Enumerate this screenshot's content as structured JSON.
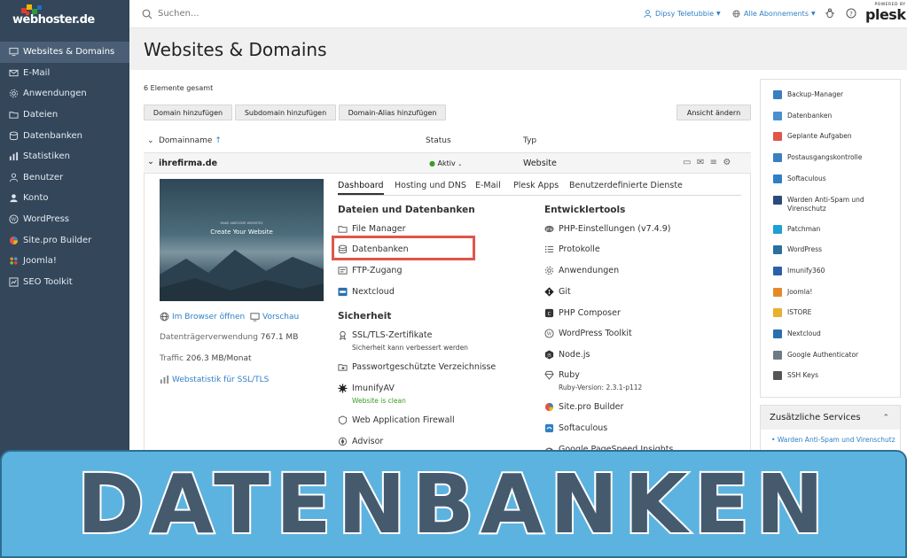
{
  "colors": {
    "sidebar": "#33465a",
    "sidebar_active": "#4a5f75",
    "link": "#2f7fc5",
    "highlight": "#e0564a",
    "banner": "#5db3df",
    "banner_text": "#465a6e",
    "status_green": "#3b9b28"
  },
  "logo": {
    "text": "webhoster.de"
  },
  "sidebar": {
    "items": [
      {
        "label": "Websites & Domains",
        "icon": "monitor-icon",
        "active": true
      },
      {
        "label": "E-Mail",
        "icon": "mail-icon"
      },
      {
        "label": "Anwendungen",
        "icon": "gear-icon"
      },
      {
        "label": "Dateien",
        "icon": "folder-icon"
      },
      {
        "label": "Datenbanken",
        "icon": "database-icon"
      },
      {
        "label": "Statistiken",
        "icon": "bar-chart-icon"
      },
      {
        "label": "Benutzer",
        "icon": "user-icon"
      },
      {
        "label": "Konto",
        "icon": "account-icon"
      },
      {
        "label": "WordPress",
        "icon": "wordpress-icon"
      },
      {
        "label": "Site.pro Builder",
        "icon": "sitepro-icon"
      },
      {
        "label": "Joomla!",
        "icon": "joomla-icon"
      },
      {
        "label": "SEO Toolkit",
        "icon": "seo-icon"
      }
    ]
  },
  "topbar": {
    "search_placeholder": "Suchen...",
    "user": "Dipsy Teletubbie",
    "subscriptions": "Alle Abonnements",
    "powered_by": "POWERED BY",
    "plesk": "plesk"
  },
  "page": {
    "title": "Websites & Domains",
    "count": "6 Elemente gesamt"
  },
  "toolbar": {
    "add_domain": "Domain hinzufügen",
    "add_subdomain": "Subdomain hinzufügen",
    "add_alias": "Domain-Alias hinzufügen",
    "change_view": "Ansicht ändern"
  },
  "table": {
    "col_domain": "Domainname",
    "col_status": "Status",
    "col_type": "Typ",
    "sort_indicator": "↑",
    "row": {
      "domain": "ihrefirma.de",
      "status": "Aktiv",
      "type": "Website"
    }
  },
  "preview": {
    "subtitle": "MAKE AWESOME WEBSITES",
    "headline": "Create Your Website",
    "open_browser": "Im Browser öffnen",
    "preview": "Vorschau",
    "disk_label": "Datenträgerverwendung",
    "disk_value": "767.1 MB",
    "traffic_label": "Traffic",
    "traffic_value": "206.3 MB/Monat",
    "stats": "Webstatistik für SSL/TLS"
  },
  "tabs": [
    "Dashboard",
    "Hosting und DNS",
    "E-Mail",
    "Plesk Apps",
    "Benutzerdefinierte Dienste"
  ],
  "dashboard": {
    "files_title": "Dateien und Datenbanken",
    "file_manager": "File Manager",
    "databases": "Datenbanken",
    "ftp": "FTP-Zugang",
    "nextcloud": "Nextcloud",
    "security_title": "Sicherheit",
    "ssl": "SSL/TLS-Zertifikate",
    "ssl_note": "Sicherheit kann verbessert werden",
    "protected_dirs": "Passwortgeschützte Verzeichnisse",
    "imunify": "ImunifyAV",
    "imunify_note": "Website is clean",
    "waf": "Web Application Firewall",
    "advisor": "Advisor",
    "dev_title": "Entwicklertools",
    "php": "PHP-Einstellungen (v7.4.9)",
    "logs": "Protokolle",
    "apps": "Anwendungen",
    "git": "Git",
    "composer": "PHP Composer",
    "wp_toolkit": "WordPress Toolkit",
    "nodejs": "Node.js",
    "ruby": "Ruby",
    "ruby_note": "Ruby-Version: 2.3.1-p112",
    "sitepro": "Site.pro Builder",
    "softaculous": "Softaculous",
    "pagespeed": "Google PageSpeed Insights"
  },
  "right_tools": [
    {
      "label": "Backup-Manager",
      "color": "#3b7fc0"
    },
    {
      "label": "Datenbanken",
      "color": "#4a8fcf"
    },
    {
      "label": "Geplante Aufgaben",
      "color": "#e0564a"
    },
    {
      "label": "Postausgangskontrolle",
      "color": "#3b7fc0"
    },
    {
      "label": "Softaculous",
      "color": "#2f7fc5"
    },
    {
      "label": "Warden Anti-Spam und Virenschutz",
      "color": "#2a4a7a"
    },
    {
      "label": "Patchman",
      "color": "#1e9fd6"
    },
    {
      "label": "WordPress",
      "color": "#2b6f9e"
    },
    {
      "label": "Imunify360",
      "color": "#2d5fa8"
    },
    {
      "label": "Joomla!",
      "color": "#e58a2b"
    },
    {
      "label": "ISTORE",
      "color": "#e8b02c"
    },
    {
      "label": "Nextcloud",
      "color": "#2a6fb0"
    },
    {
      "label": "Google Authenticator",
      "color": "#6d7b86"
    },
    {
      "label": "SSH Keys",
      "color": "#555555"
    }
  ],
  "extra_services": {
    "title": "Zusätzliche Services",
    "link": "Warden Anti-Spam und Virenschutz"
  },
  "banner": {
    "text": "DATENBANKEN"
  }
}
